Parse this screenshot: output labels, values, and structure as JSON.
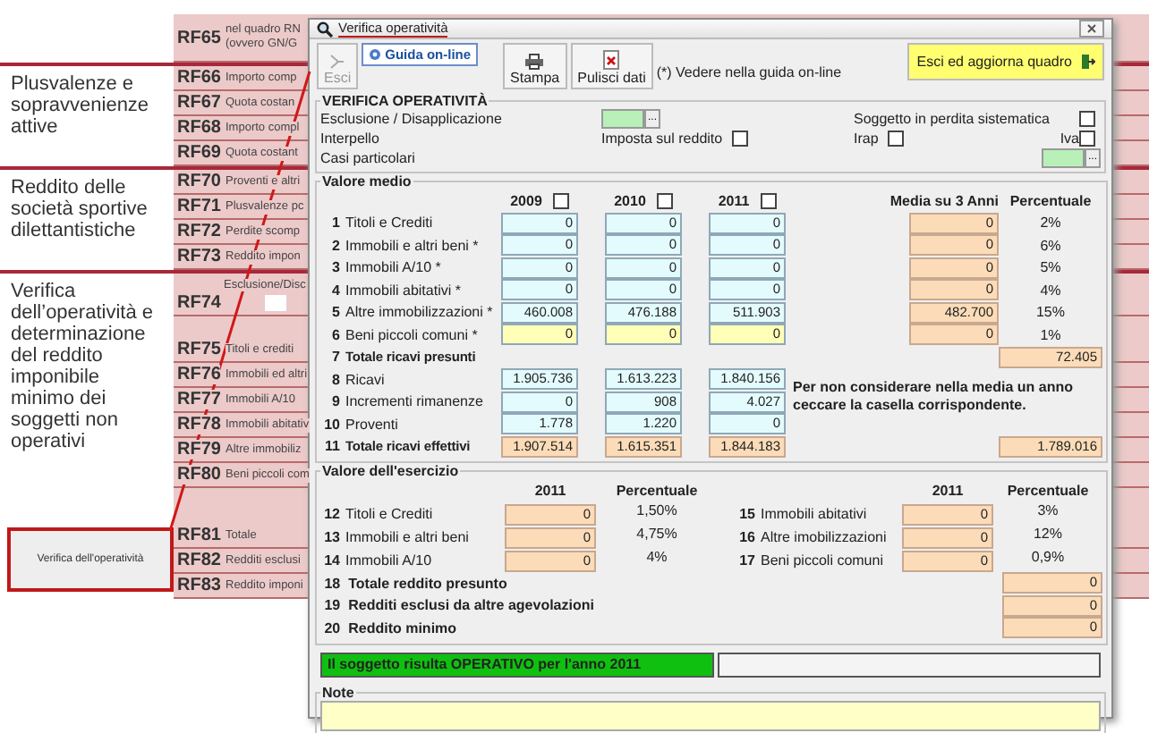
{
  "background_form": {
    "groups": [
      {
        "rows": [
          {
            "code": "RF65",
            "lines": [
              "nel quadro RN",
              "(ovvero GN/G"
            ]
          }
        ]
      },
      {
        "label": "Plusvalenze e sopravvenienze attive",
        "rows": [
          {
            "code": "RF66",
            "lines": [
              "Importo comp"
            ]
          },
          {
            "code": "RF67",
            "lines": [
              "Quota costan"
            ]
          },
          {
            "code": "RF68",
            "lines": [
              "Importo compl"
            ]
          },
          {
            "code": "RF69",
            "lines": [
              "Quota costant"
            ]
          }
        ]
      },
      {
        "label": "Reddito delle società sportive dilettantistiche",
        "rows": [
          {
            "code": "RF70",
            "lines": [
              "Proventi e altri"
            ]
          },
          {
            "code": "RF71",
            "lines": [
              "Plusvalenze pc"
            ]
          },
          {
            "code": "RF72",
            "lines": [
              "Perdite scomp"
            ]
          },
          {
            "code": "RF73",
            "lines": [
              "Reddito impon"
            ]
          }
        ]
      },
      {
        "label": "Verifica dell’operatività e determinazione del reddito imponibile minimo dei soggetti non operativi",
        "caption": "Esclusione/Disc",
        "lead_row": {
          "code": "RF74"
        },
        "rows": [
          {
            "code": "RF75",
            "lines": [
              "Titoli e crediti"
            ]
          },
          {
            "code": "RF76",
            "lines": [
              "Immobili ed altri"
            ]
          },
          {
            "code": "RF77",
            "lines": [
              "Immobili A/10"
            ]
          },
          {
            "code": "RF78",
            "lines": [
              "Immobili abitativ"
            ]
          },
          {
            "code": "RF79",
            "lines": [
              "Altre immobiliz"
            ]
          },
          {
            "code": "RF80",
            "lines": [
              "Beni piccoli com"
            ]
          }
        ],
        "total_rows": [
          {
            "code": "RF81",
            "lines": [
              "Totale"
            ]
          },
          {
            "code": "RF82",
            "lines": [
              "Redditi esclusi"
            ]
          },
          {
            "code": "RF83",
            "lines": [
              "Reddito imponi"
            ]
          }
        ],
        "link_box": {
          "label": "Verifica dell'operatività"
        }
      }
    ]
  },
  "dialog": {
    "title": "Verifica operatività",
    "toolbar": {
      "exit": {
        "label": "Esci",
        "disabled": true
      },
      "help": {
        "label": "Guida on-line"
      },
      "print": {
        "label": "Stampa"
      },
      "clear": {
        "label": "Pulisci dati"
      },
      "note": "(*) Vedere nella guida on-line",
      "save_exit": {
        "label": "Esci ed aggiorna quadro"
      }
    },
    "verifica": {
      "title": "VERIFICA OPERATIVITÀ",
      "esclusione": {
        "label": "Esclusione / Disapplicazione",
        "browse": "..."
      },
      "perdita": {
        "label": "Soggetto in perdita sistematica",
        "checked": false
      },
      "interpello": "Interpello",
      "imposta": {
        "label": "Imposta sul reddito",
        "checked": false
      },
      "irap": {
        "label": "Irap",
        "checked": false
      },
      "iva": {
        "label": "Iva",
        "checked": false
      },
      "casi": {
        "label": "Casi particolari",
        "browse": "..."
      }
    },
    "valore_medio": {
      "title": "Valore medio",
      "years": [
        {
          "label": "2009",
          "checked": false
        },
        {
          "label": "2010",
          "checked": false
        },
        {
          "label": "2011",
          "checked": false
        }
      ],
      "media_header": "Media su 3 Anni",
      "perc_header": "Percentuale",
      "rows": [
        {
          "kind": "entry",
          "num": "1",
          "label": "Titoli e Crediti",
          "values": [
            "0",
            "0",
            "0"
          ],
          "media": "0",
          "perc": "2%"
        },
        {
          "kind": "entry",
          "num": "2",
          "label": "Immobili e altri beni *",
          "values": [
            "0",
            "0",
            "0"
          ],
          "media": "0",
          "perc": "6%"
        },
        {
          "kind": "entry",
          "num": "3",
          "label": "Immobili A/10 *",
          "values": [
            "0",
            "0",
            "0"
          ],
          "media": "0",
          "perc": "5%"
        },
        {
          "kind": "entry",
          "num": "4",
          "label": "Immobili abitativi *",
          "values": [
            "0",
            "0",
            "0"
          ],
          "media": "0",
          "perc": "4%"
        },
        {
          "kind": "entry",
          "num": "5",
          "label": "Altre immobilizzazioni *",
          "values": [
            "460.008",
            "476.188",
            "511.903"
          ],
          "media": "482.700",
          "perc": "15%"
        },
        {
          "kind": "special",
          "num": "6",
          "label": "Beni piccoli comuni *",
          "values": [
            "0",
            "0",
            "0"
          ],
          "media": "0",
          "perc": "1%"
        },
        {
          "kind": "result",
          "num": "7",
          "label": "Totale ricavi presunti",
          "total": "72.405"
        },
        {
          "kind": "entry",
          "num": "8",
          "label": "Ricavi",
          "values": [
            "1.905.736",
            "1.613.223",
            "1.840.156"
          ]
        },
        {
          "kind": "entry",
          "num": "9",
          "label": "Incrementi rimanenze",
          "values": [
            "0",
            "908",
            "4.027"
          ]
        },
        {
          "kind": "entry",
          "num": "10",
          "label": "Proventi",
          "values": [
            "1.778",
            "1.220",
            "0"
          ]
        },
        {
          "kind": "total",
          "num": "11",
          "label": "Totale ricavi effettivi",
          "values": [
            "1.907.514",
            "1.615.351",
            "1.844.183"
          ],
          "total": "1.789.016"
        }
      ],
      "hint": "Per non considerare nella media un anno ceccare la casella corrispondente."
    },
    "valore_esercizio": {
      "title": "Valore dell'esercizio",
      "headers": [
        {
          "year": "2011",
          "perc": "Percentuale"
        },
        {
          "year": "2011",
          "perc": "Percentuale"
        }
      ],
      "left_rows": [
        {
          "num": "12",
          "label": "Titoli e Crediti",
          "value": "0",
          "perc": "1,50%"
        },
        {
          "num": "13",
          "label": "Immobili e altri beni",
          "value": "0",
          "perc": "4,75%"
        },
        {
          "num": "14",
          "label": "Immobili A/10",
          "value": "0",
          "perc": "4%"
        }
      ],
      "right_rows": [
        {
          "num": "15",
          "label": "Immobili abitativi",
          "value": "0",
          "perc": "3%"
        },
        {
          "num": "16",
          "label": "Altre imobilizzazioni",
          "value": "0",
          "perc": "12%"
        },
        {
          "num": "17",
          "label": "Beni piccoli comuni",
          "value": "0",
          "perc": "0,9%"
        }
      ],
      "summary_rows": [
        {
          "num": "18",
          "label": "Totale reddito presunto",
          "value": "0"
        },
        {
          "num": "19",
          "label": "Redditi esclusi da altre agevolazioni",
          "value": "0"
        },
        {
          "num": "20",
          "label": "Reddito minimo",
          "value": "0"
        }
      ]
    },
    "status": {
      "text": "Il soggetto risulta OPERATIVO per l'anno 2011",
      "operative": true
    },
    "note": {
      "title": "Note"
    }
  }
}
